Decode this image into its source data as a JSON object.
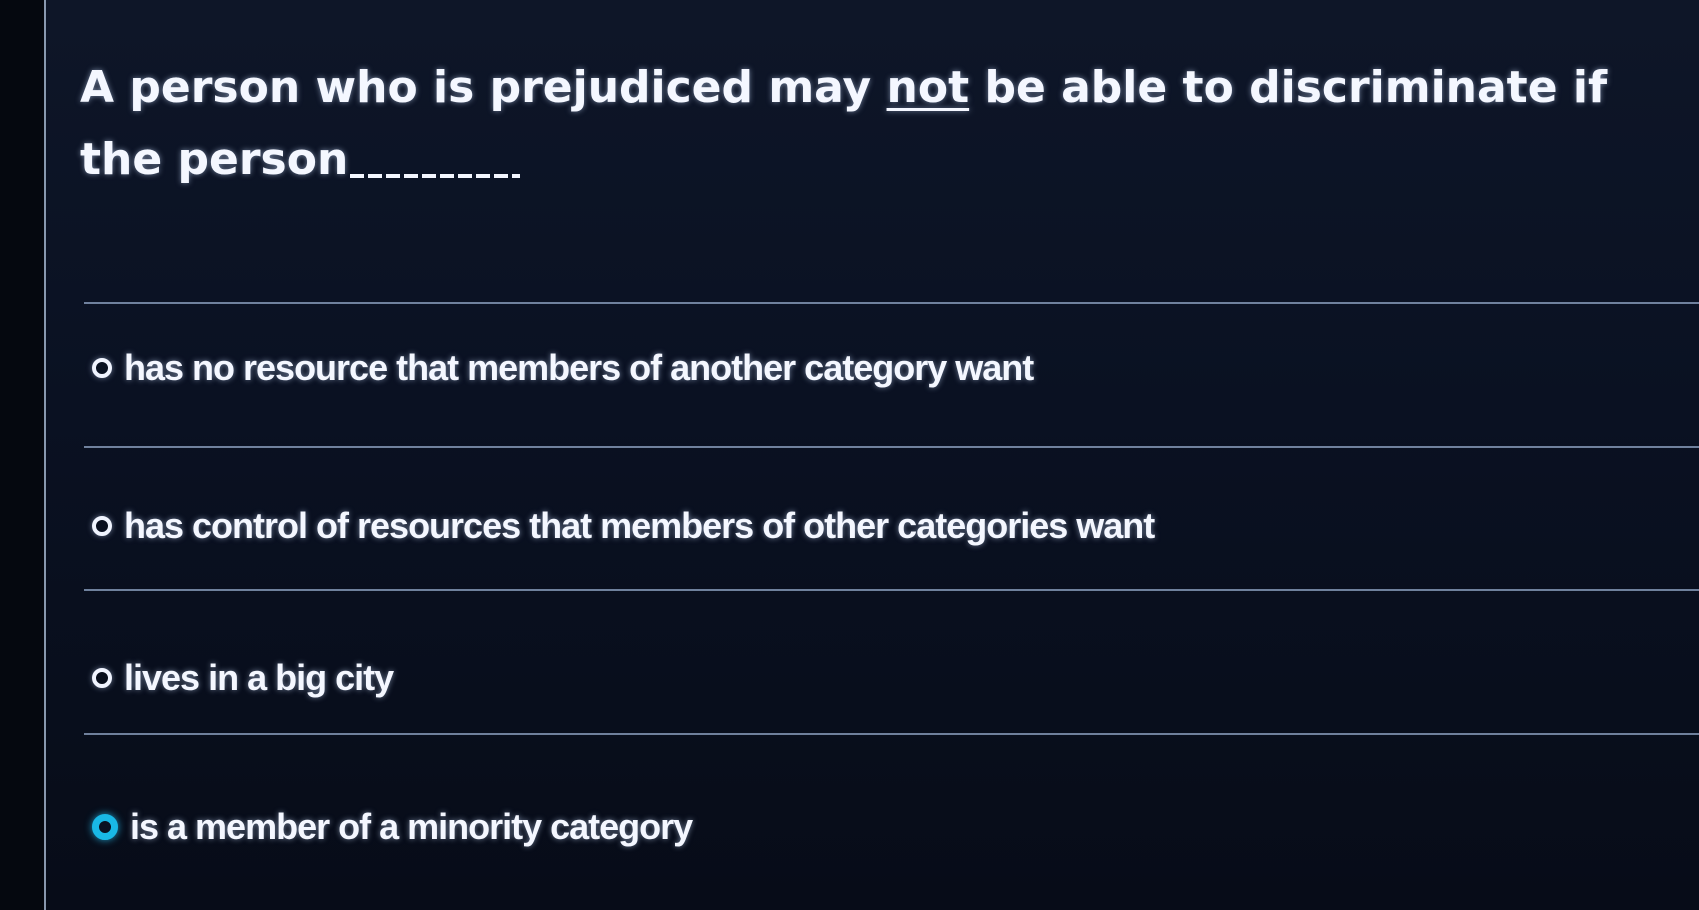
{
  "question": {
    "text_before": "A person who is prejudiced may ",
    "emphasis": "not",
    "text_after": " be able to discriminate if the person"
  },
  "options": [
    {
      "label": "has no resource that members of another category want",
      "selected": false
    },
    {
      "label": "has control of resources that members of other categories want",
      "selected": false
    },
    {
      "label": "lives in a big city",
      "selected": false
    },
    {
      "label": "is a member of a minority category",
      "selected": true
    }
  ],
  "colors": {
    "background": "#0a1122",
    "text": "#f4f7ff",
    "selected_radio": "#19b8e6"
  }
}
